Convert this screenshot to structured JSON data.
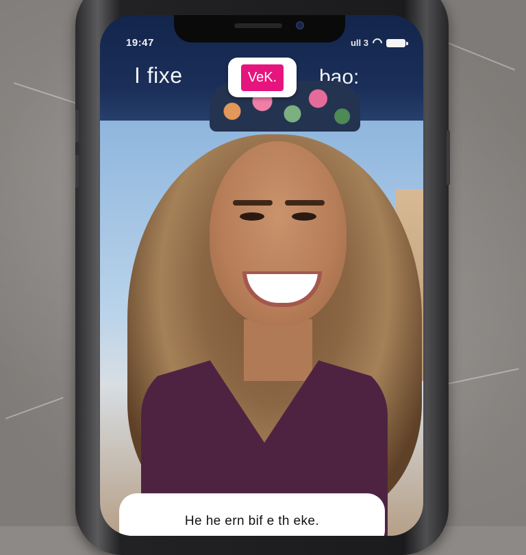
{
  "status_bar": {
    "time": "19:47",
    "carrier": "ull 3",
    "wifi_icon": "wifi-icon",
    "battery_icon": "battery-icon"
  },
  "story": {
    "title_left": "I fixe",
    "title_right": "bao:",
    "brand_label": "VeK.",
    "brand_color": "#e6157e",
    "caption": "He he ern bif e th eke."
  },
  "colors": {
    "header": "#13254b",
    "background": "#8d8986",
    "caption_card": "#ffffff"
  }
}
